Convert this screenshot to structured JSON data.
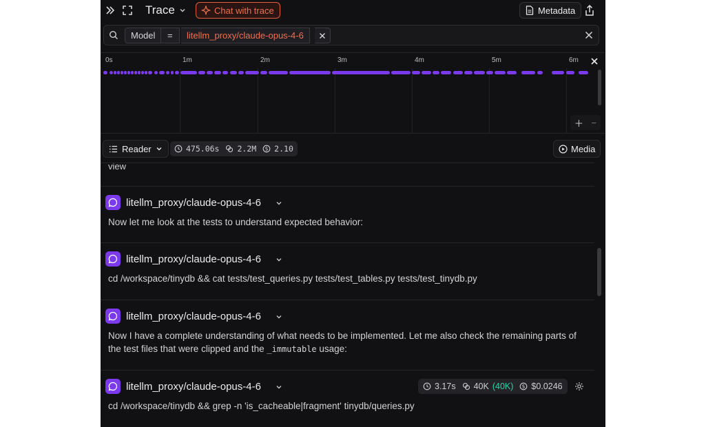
{
  "header": {
    "title": "Trace",
    "chat_label": "Chat with trace",
    "metadata_label": "Metadata"
  },
  "filter": {
    "key": "Model",
    "op": "=",
    "value": "litellm_proxy/claude-opus-4-6"
  },
  "timeline": {
    "ticks": [
      "0s",
      "1m",
      "2m",
      "3m",
      "4m",
      "5m",
      "6m"
    ],
    "accent": "#7c3aed"
  },
  "toolbar": {
    "view_label": "Reader",
    "duration": "475.06s",
    "tokens": "2.2M",
    "cost": "2.10",
    "media_label": "Media"
  },
  "messages": {
    "prev_tail": "view",
    "items": [
      {
        "model": "litellm_proxy/claude-opus-4-6",
        "text": "Now let me look at the tests to understand expected behavior:"
      },
      {
        "model": "litellm_proxy/claude-opus-4-6",
        "text": "cd /workspace/tinydb && cat tests/test_queries.py tests/test_tables.py tests/test_tinydb.py"
      },
      {
        "model": "litellm_proxy/claude-opus-4-6",
        "text_a": "Now I have a complete understanding of what needs to be implemented. Let me also check the remaining parts of the test files that were clipped and the ",
        "code": "_immutable",
        "text_b": " usage:"
      },
      {
        "model": "litellm_proxy/claude-opus-4-6",
        "text": "cd /workspace/tinydb && grep -n 'is_cacheable|fragment' tinydb/queries.py",
        "duration": "3.17s",
        "tokens": "40K",
        "cached": "(40K)",
        "cost": "$0.0246"
      }
    ]
  }
}
